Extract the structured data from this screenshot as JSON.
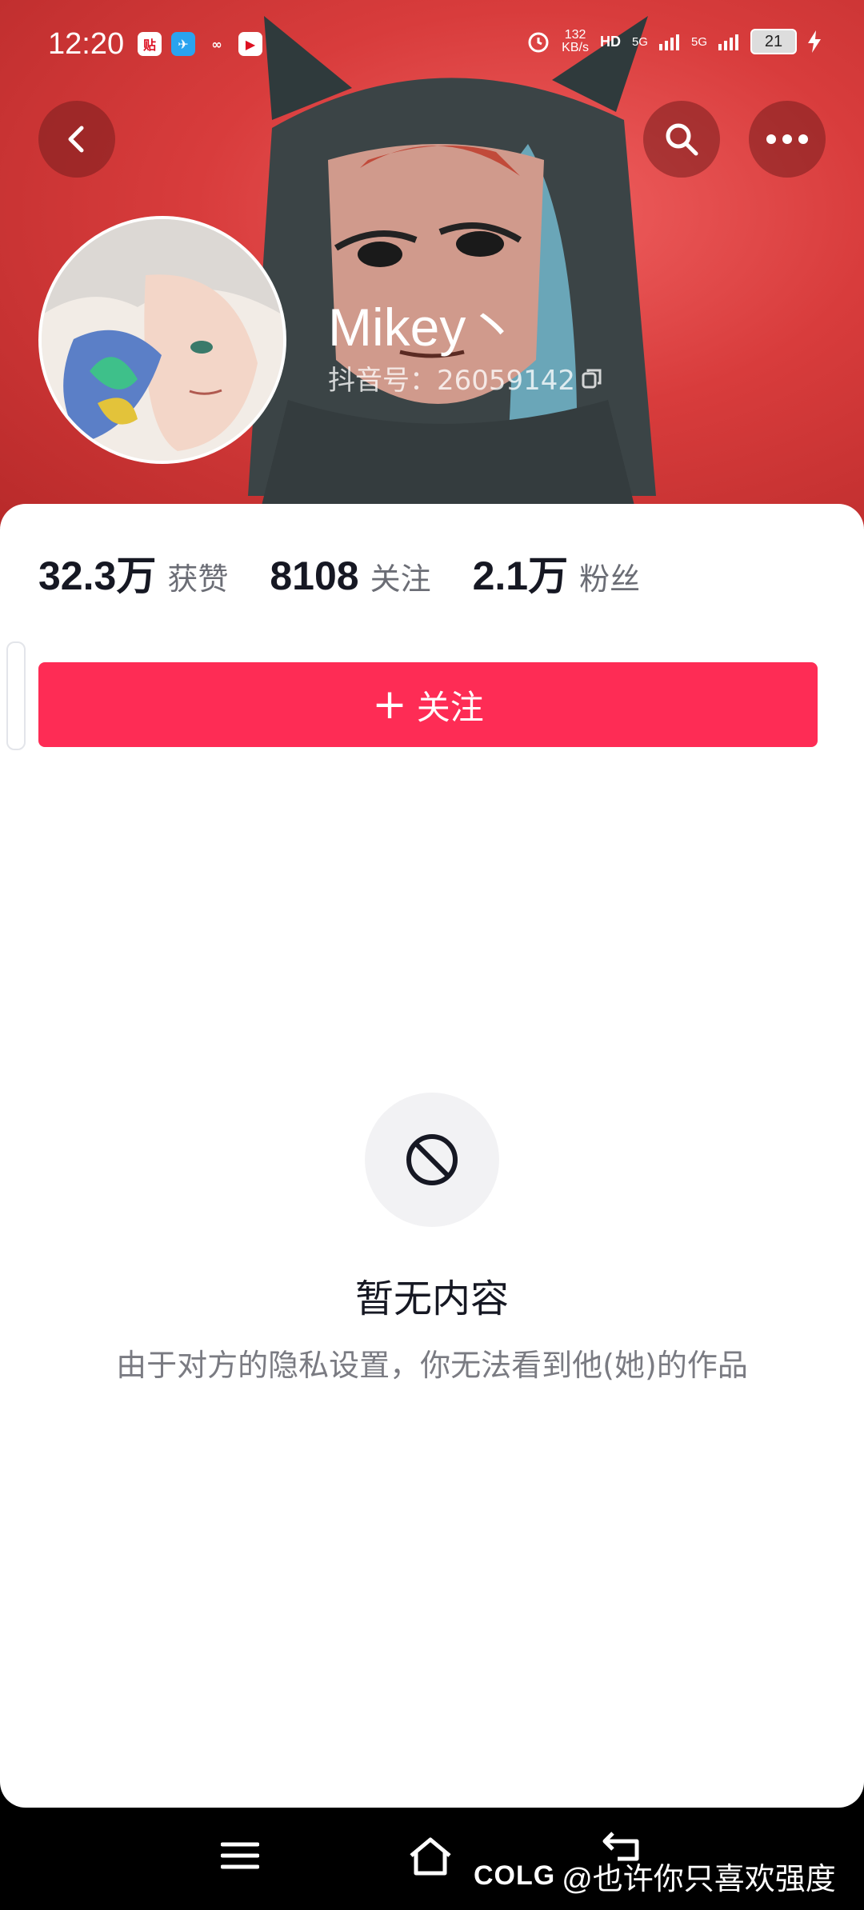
{
  "status_bar": {
    "time": "12:20",
    "app_icons": [
      "贴",
      "✈",
      "∞",
      "▶"
    ],
    "net_speed_top": "132",
    "net_speed_bottom": "KB/s",
    "hd_tag": "HD",
    "sim1": "5G",
    "sim2": "5G",
    "battery": "21"
  },
  "profile": {
    "username": "Mikey丶",
    "douyin_id": "抖音号：26059142"
  },
  "stats": [
    {
      "num": "32.3万",
      "label": "获赞"
    },
    {
      "num": "8108",
      "label": "关注"
    },
    {
      "num": "2.1万",
      "label": "粉丝"
    }
  ],
  "follow_button": {
    "icon": "+",
    "label": "关注"
  },
  "empty_state": {
    "title": "暂无内容",
    "description": "由于对方的隐私设置，你无法看到他(她)的作品"
  },
  "watermark": {
    "logo": "COLG",
    "text": "@也许你只喜欢强度"
  },
  "colors": {
    "header_red": "#d83c3c",
    "follow_pink": "#fe2c55",
    "text_dark": "#161823",
    "text_gray": "#6b6d75"
  }
}
